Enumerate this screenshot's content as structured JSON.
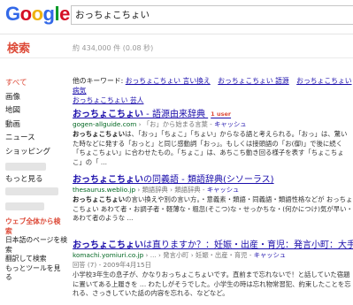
{
  "logo": {
    "letters": [
      "G",
      "o",
      "o",
      "g",
      "l",
      "e"
    ],
    "colors": [
      "#3369e8",
      "#d50f25",
      "#eeb211",
      "#3369e8",
      "#009925",
      "#d50f25"
    ]
  },
  "search": {
    "query": "おっちょこちょい"
  },
  "header": {
    "search_label": "検索",
    "stats": "約 434,000 件 (0.08 秒)"
  },
  "sidebar": {
    "items": [
      {
        "label": "すべて",
        "active": true
      },
      {
        "label": "画像",
        "active": false
      },
      {
        "label": "地図",
        "active": false
      },
      {
        "label": "動画",
        "active": false
      },
      {
        "label": "ニュース",
        "active": false
      },
      {
        "label": "ショッピング",
        "active": false
      },
      {
        "label": "",
        "active": false
      },
      {
        "label": "もっと見る",
        "active": false
      }
    ],
    "web_all": "ウェブ全体から検索",
    "japanese_only": "日本語のページを検索",
    "translated": "翻訳して検索",
    "more_tools": "もっとツールを見る"
  },
  "keywords": {
    "label": "他のキーワード:",
    "items": [
      "おっちょこちょい 言い換え",
      "おっちょこちょい 語源",
      "おっちょこちょい 病気",
      "おっちょこちょい 芸人"
    ]
  },
  "results": [
    {
      "title_bold": "おっちょこちょい",
      "title_rest": " - 語源由来辞典",
      "badge": "1 user",
      "url_green": "gogen-allguide.com",
      "url_rest": " › 「お」から始まる言葉 - ",
      "cache": "キャッシュ",
      "snippet_bold": "おっちょこちょい",
      "snippet": "は、「おっ」「ちょこ」「ちょい」からなる語と考えられる。「おっ」は、驚いた時などに発する「おっと」と同じ感動詞「おっ」。もしくは接頭語の「お(御)」で後に続く「ちょこちょい」に合わせたもの。「ちょこ」は、あちこち動き回る様子を表す「ちょこちょこ」の「 ..."
    },
    {
      "title_bold": "おっちょこちょい",
      "title_rest": "の同義語 - 類語辞典(シソーラス)",
      "url_green": "thesaurus.weblio.jp",
      "url_rest": " › 類語辞典 › 類語辞典 - ",
      "cache": "キャッシュ",
      "snippet_bold": "おっちょこちょい",
      "snippet": "の言い換えや別の言い方。・意義素・類語・同義語・類語性格などが おっちょこちょい あわて者・お調子者・軽薄な・粗忽(そこつ)な・せっかちな・(何かにつけ)気が早い・あわて者のような ..."
    },
    {
      "title_bold": "おっちょこちょい",
      "title_rest": "は直りますか？：妊娠・出産・育児：発言小町：大手小...",
      "url_green": "komachi.yomiuri.co.jp",
      "url_rest": " › ... › 発言小町 › 妊娠・出産・育児 - ",
      "cache": "キャッシュ",
      "date": "回答 (7) - 2009年4月15日",
      "snippet": "小学校3年生の息子が、かなりおっちょこちょいです。直前まで忘れないで！と話していた宿題に置いてある上履きを … わたしがそうでした。小学生の時は忘れ物常習犯、約束したことを忘れる、さっきしていた話の内容を忘れる、などなど。"
    }
  ]
}
